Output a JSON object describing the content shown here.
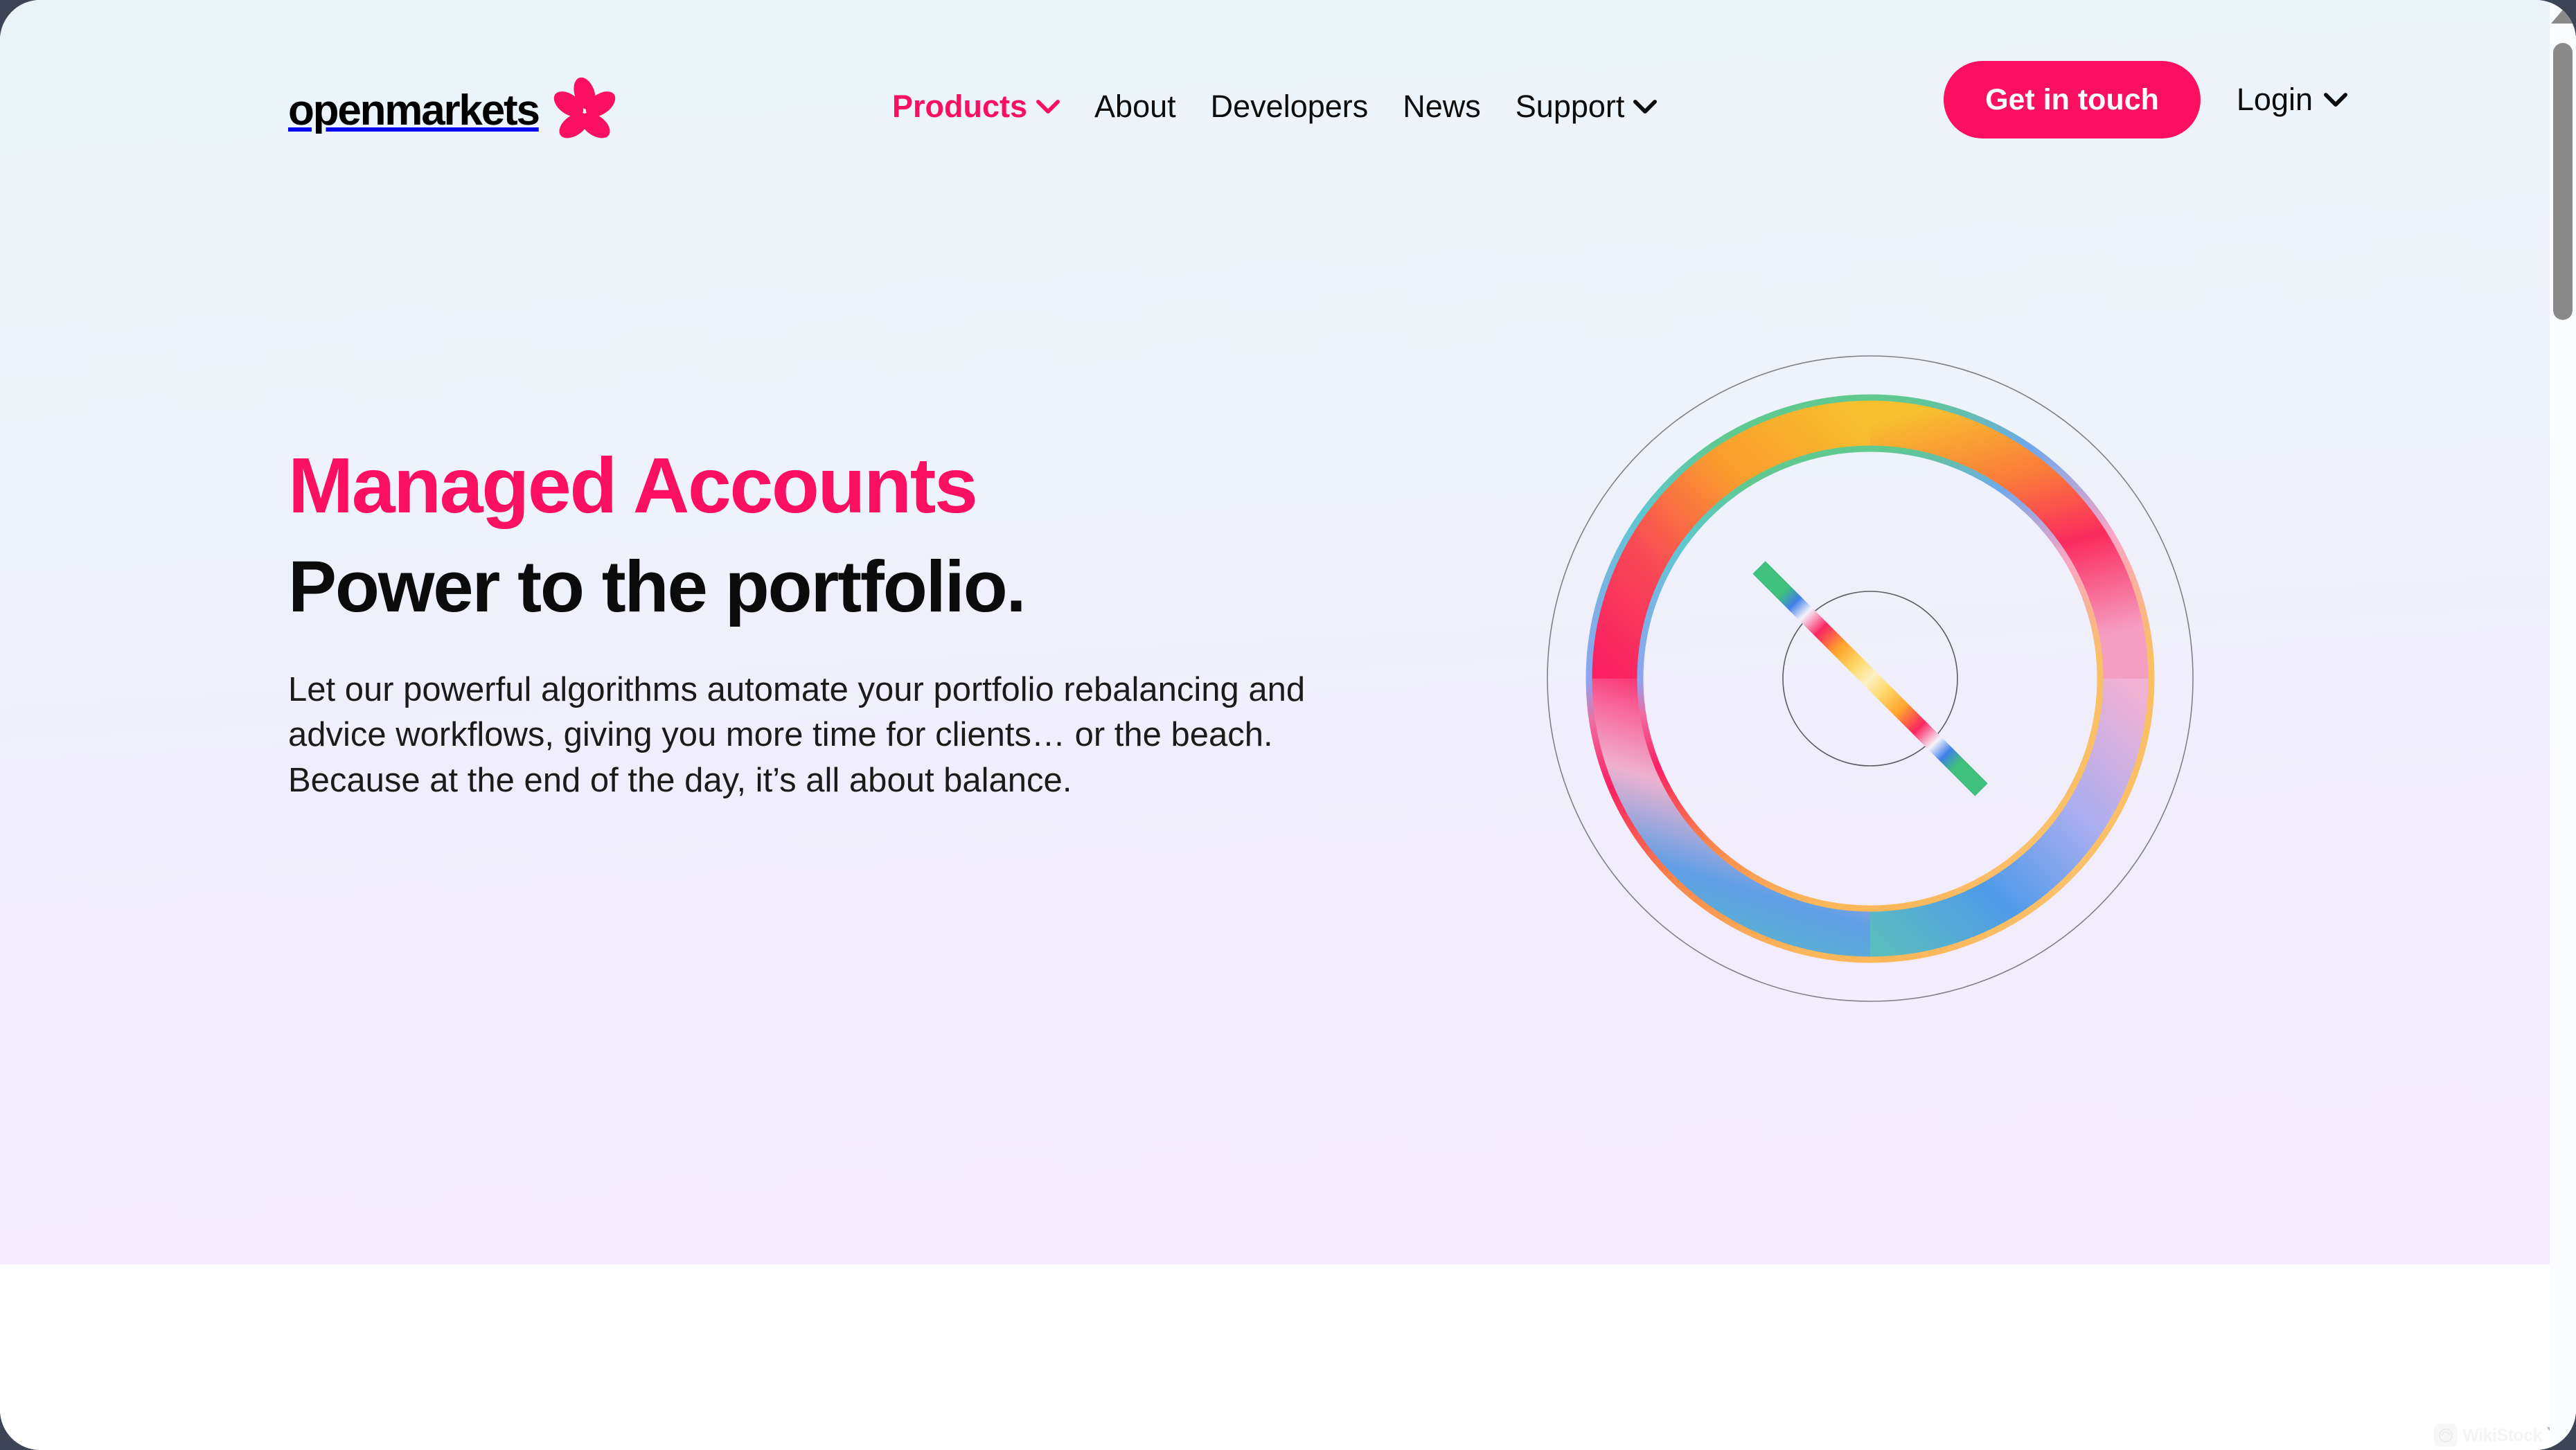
{
  "brand": {
    "name": "openmarkets",
    "logo_icon": "flower-icon",
    "accent_color": "#fa0f61",
    "text_color": "#0b0b0b"
  },
  "nav": {
    "items": [
      {
        "label": "Products",
        "has_dropdown": true,
        "active": true,
        "icon": "chevron-down-icon"
      },
      {
        "label": "About",
        "has_dropdown": false,
        "active": false,
        "icon": ""
      },
      {
        "label": "Developers",
        "has_dropdown": false,
        "active": false,
        "icon": ""
      },
      {
        "label": "News",
        "has_dropdown": false,
        "active": false,
        "icon": ""
      },
      {
        "label": "Support",
        "has_dropdown": true,
        "active": false,
        "icon": "chevron-down-icon"
      }
    ],
    "cta_label": "Get in touch",
    "login_label": "Login",
    "login_icon": "chevron-down-icon"
  },
  "hero": {
    "eyebrow": "Managed Accounts",
    "headline": "Power to the portfolio.",
    "body": "Let our powerful algorithms automate your portfolio rebalancing and advice workflows, giving you more time for clients… or the beach. Because at the end of the day, it’s all about balance.",
    "background_top": "#e9f4f7",
    "background_bottom": "#f4ebfd"
  },
  "graphic": {
    "name": "portfolio-balance-gauge",
    "description": "Concentric circles with a thick multi-colour gradient ring and a diagonal gradient needle",
    "outer_guide_circle": true,
    "inner_guide_circle": true,
    "ring_gradient_stops": [
      "#5fc98f",
      "#f7c02f",
      "#fa9b2e",
      "#f84a55",
      "#fa2063",
      "#f6a8c4",
      "#f1b6d6",
      "#8ea4f0",
      "#4f9ae8",
      "#57b8c6",
      "#5fc98f"
    ],
    "needle_gradient_stops": [
      "#3fc07c",
      "#3f7fe8",
      "#ffffff",
      "#fa2663",
      "#ffc033",
      "#ffd96b",
      "#ffc033",
      "#fa2663",
      "#ffffff",
      "#3f7fe8",
      "#3fc07c"
    ],
    "needle_angle_deg": 45
  },
  "watermark": {
    "label": "WikiStock",
    "icon": "wikistock-icon",
    "caret_icon": "caret-down-icon"
  },
  "scrollbar": {
    "up_arrow_icon": "scroll-up-arrow-icon",
    "thumb": "scrollbar-thumb"
  }
}
